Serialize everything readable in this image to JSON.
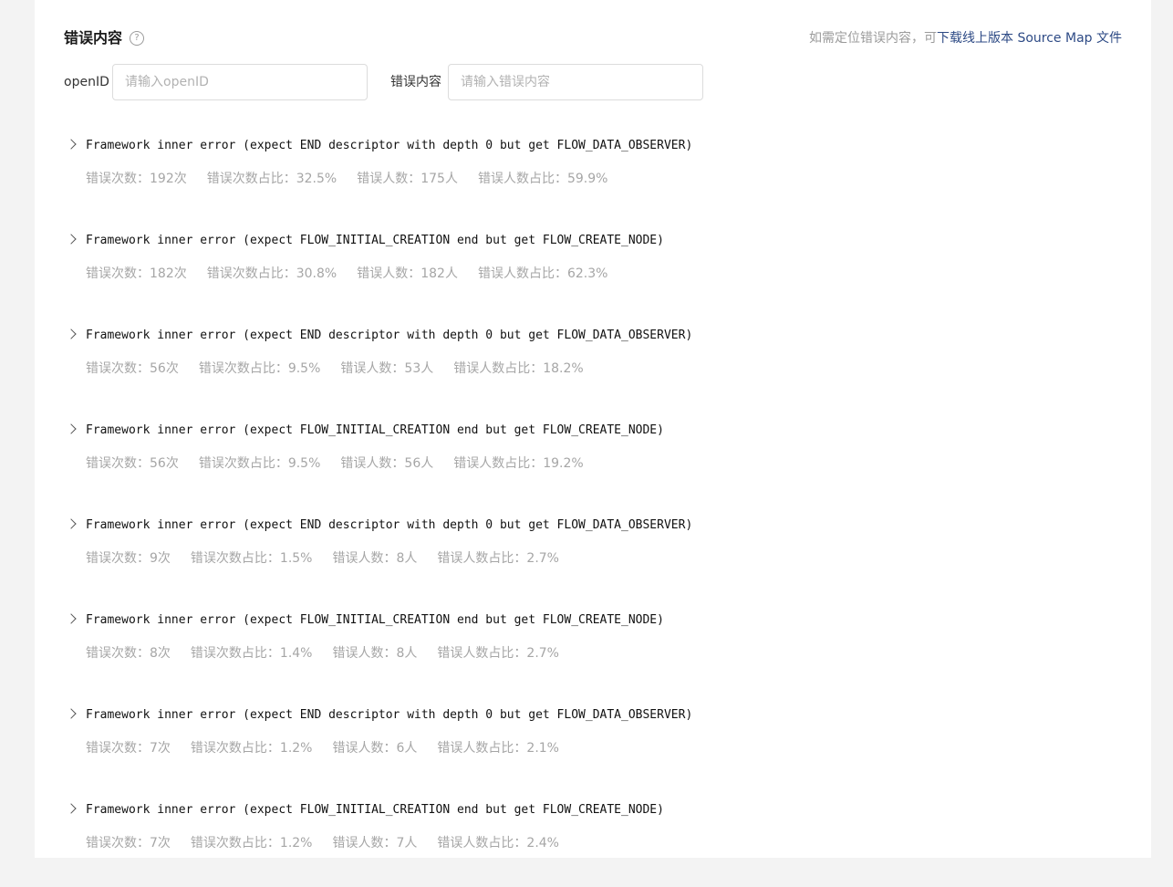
{
  "header": {
    "title": "错误内容",
    "help_icon": "question-circle-icon",
    "hint_prefix": "如需定位错误内容，可",
    "hint_link": "下载线上版本 Source Map 文件"
  },
  "filters": {
    "openid_label": "openID",
    "openid_placeholder": "请输入openID",
    "content_label": "错误内容",
    "content_placeholder": "请输入错误内容"
  },
  "errors": [
    {
      "message": "Framework inner error (expect END descriptor with depth 0 but get FLOW_DATA_OBSERVER)",
      "count": "错误次数：192次",
      "count_ratio": "错误次数占比：32.5%",
      "users": "错误人数：175人",
      "users_ratio": "错误人数占比：59.9%"
    },
    {
      "message": "Framework inner error (expect FLOW_INITIAL_CREATION end but get FLOW_CREATE_NODE)",
      "count": "错误次数：182次",
      "count_ratio": "错误次数占比：30.8%",
      "users": "错误人数：182人",
      "users_ratio": "错误人数占比：62.3%"
    },
    {
      "message": "Framework inner error (expect END descriptor with depth 0 but get FLOW_DATA_OBSERVER)",
      "count": "错误次数：56次",
      "count_ratio": "错误次数占比：9.5%",
      "users": "错误人数：53人",
      "users_ratio": "错误人数占比：18.2%"
    },
    {
      "message": "Framework inner error (expect FLOW_INITIAL_CREATION end but get FLOW_CREATE_NODE)",
      "count": "错误次数：56次",
      "count_ratio": "错误次数占比：9.5%",
      "users": "错误人数：56人",
      "users_ratio": "错误人数占比：19.2%"
    },
    {
      "message": "Framework inner error (expect END descriptor with depth 0 but get FLOW_DATA_OBSERVER)",
      "count": "错误次数：9次",
      "count_ratio": "错误次数占比：1.5%",
      "users": "错误人数：8人",
      "users_ratio": "错误人数占比：2.7%"
    },
    {
      "message": "Framework inner error (expect FLOW_INITIAL_CREATION end but get FLOW_CREATE_NODE)",
      "count": "错误次数：8次",
      "count_ratio": "错误次数占比：1.4%",
      "users": "错误人数：8人",
      "users_ratio": "错误人数占比：2.7%"
    },
    {
      "message": "Framework inner error (expect END descriptor with depth 0 but get FLOW_DATA_OBSERVER)",
      "count": "错误次数：7次",
      "count_ratio": "错误次数占比：1.2%",
      "users": "错误人数：6人",
      "users_ratio": "错误人数占比：2.1%"
    },
    {
      "message": "Framework inner error (expect FLOW_INITIAL_CREATION end but get FLOW_CREATE_NODE)",
      "count": "错误次数：7次",
      "count_ratio": "错误次数占比：1.2%",
      "users": "错误人数：7人",
      "users_ratio": "错误人数占比：2.4%"
    }
  ],
  "colors": {
    "link": "#2d4a85",
    "muted": "#a6a6a6",
    "page_bg": "#f3f3f3"
  }
}
